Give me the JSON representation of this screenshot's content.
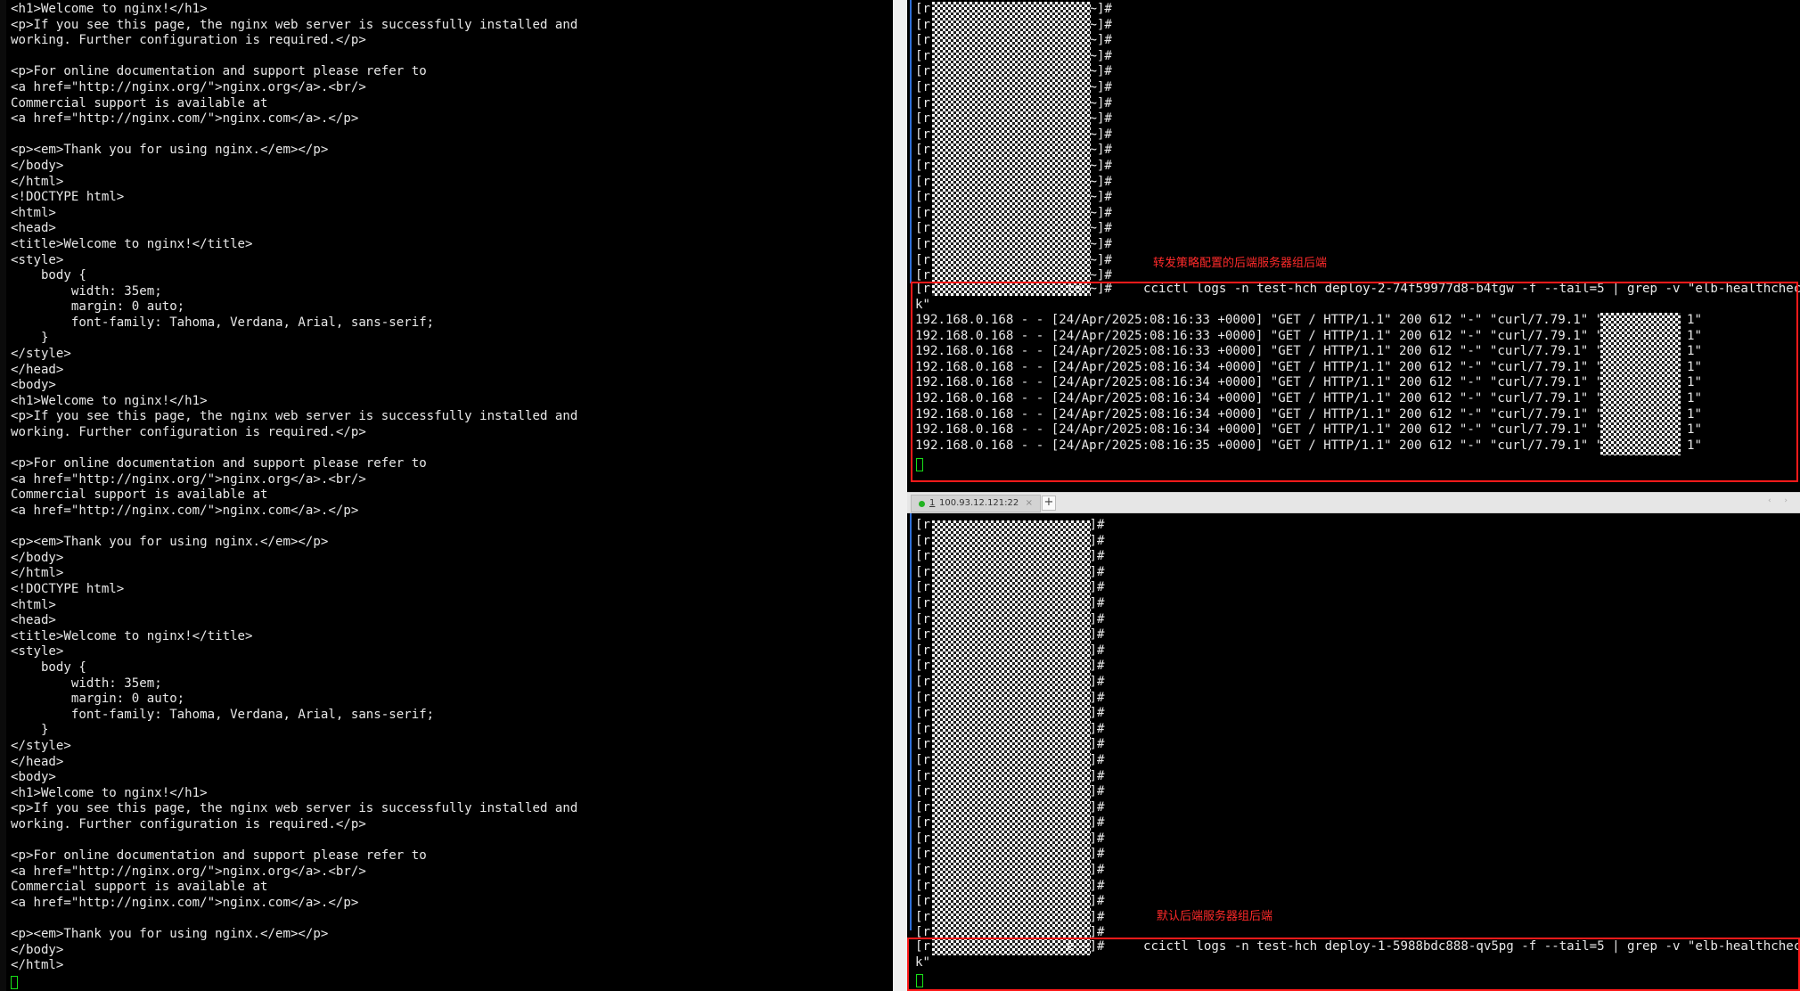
{
  "left_terminal": {
    "lines": [
      "<h1>Welcome to nginx!</h1>",
      "<p>If you see this page, the nginx web server is successfully installed and",
      "working. Further configuration is required.</p>",
      "",
      "<p>For online documentation and support please refer to",
      "<a href=\"http://nginx.org/\">nginx.org</a>.<br/>",
      "Commercial support is available at",
      "<a href=\"http://nginx.com/\">nginx.com</a>.</p>",
      "",
      "<p><em>Thank you for using nginx.</em></p>",
      "</body>",
      "</html>",
      "<!DOCTYPE html>",
      "<html>",
      "<head>",
      "<title>Welcome to nginx!</title>",
      "<style>",
      "    body {",
      "        width: 35em;",
      "        margin: 0 auto;",
      "        font-family: Tahoma, Verdana, Arial, sans-serif;",
      "    }",
      "</style>",
      "</head>",
      "<body>",
      "<h1>Welcome to nginx!</h1>",
      "<p>If you see this page, the nginx web server is successfully installed and",
      "working. Further configuration is required.</p>",
      "",
      "<p>For online documentation and support please refer to",
      "<a href=\"http://nginx.org/\">nginx.org</a>.<br/>",
      "Commercial support is available at",
      "<a href=\"http://nginx.com/\">nginx.com</a>.</p>",
      "",
      "<p><em>Thank you for using nginx.</em></p>",
      "</body>",
      "</html>",
      "<!DOCTYPE html>",
      "<html>",
      "<head>",
      "<title>Welcome to nginx!</title>",
      "<style>",
      "    body {",
      "        width: 35em;",
      "        margin: 0 auto;",
      "        font-family: Tahoma, Verdana, Arial, sans-serif;",
      "    }",
      "</style>",
      "</head>",
      "<body>",
      "<h1>Welcome to nginx!</h1>",
      "<p>If you see this page, the nginx web server is successfully installed and",
      "working. Further configuration is required.</p>",
      "",
      "<p>For online documentation and support please refer to",
      "<a href=\"http://nginx.org/\">nginx.org</a>.<br/>",
      "Commercial support is available at",
      "<a href=\"http://nginx.com/\">nginx.com</a>.</p>",
      "",
      "<p><em>Thank you for using nginx.</em></p>",
      "</body>",
      "</html>"
    ]
  },
  "top_terminal": {
    "prompt_prefix": "[r",
    "prompt_suffix": "te ~]#",
    "annotation": "转发策略配置的后端服务器组后端",
    "command": "ccictl logs -n test-hch deploy-2-74f59977d8-b4tgw -f --tail=5 | grep -v \"elb-healthchec",
    "command_wrap": "k\"",
    "log_lines": [
      {
        "text": "192.168.0.168 - - [24/Apr/2025:08:16:33 +0000] \"GET / HTTP/1.1\" 200 612 \"-\" \"curl/7.79.1\" \"10",
        "tail": "1\""
      },
      {
        "text": "192.168.0.168 - - [24/Apr/2025:08:16:33 +0000] \"GET / HTTP/1.1\" 200 612 \"-\" \"curl/7.79.1\" \"10",
        "tail": "1\""
      },
      {
        "text": "192.168.0.168 - - [24/Apr/2025:08:16:33 +0000] \"GET / HTTP/1.1\" 200 612 \"-\" \"curl/7.79.1\" \"10",
        "tail": "1\""
      },
      {
        "text": "192.168.0.168 - - [24/Apr/2025:08:16:34 +0000] \"GET / HTTP/1.1\" 200 612 \"-\" \"curl/7.79.1\" \"10",
        "tail": "1\""
      },
      {
        "text": "192.168.0.168 - - [24/Apr/2025:08:16:34 +0000] \"GET / HTTP/1.1\" 200 612 \"-\" \"curl/7.79.1\" \"10",
        "tail": "1\""
      },
      {
        "text": "192.168.0.168 - - [24/Apr/2025:08:16:34 +0000] \"GET / HTTP/1.1\" 200 612 \"-\" \"curl/7.79.1\" \"10",
        "tail": "1\""
      },
      {
        "text": "192.168.0.168 - - [24/Apr/2025:08:16:34 +0000] \"GET / HTTP/1.1\" 200 612 \"-\" \"curl/7.79.1\" \"10",
        "tail": "1\""
      },
      {
        "text": "192.168.0.168 - - [24/Apr/2025:08:16:34 +0000] \"GET / HTTP/1.1\" 200 612 \"-\" \"curl/7.79.1\" \"10",
        "tail": "1\""
      },
      {
        "text": "192.168.0.168 - - [24/Apr/2025:08:16:35 +0000] \"GET / HTTP/1.1\" 200 612 \"-\" \"curl/7.79.1\" \"10",
        "tail": "1\""
      }
    ]
  },
  "tab_bar": {
    "tab_number": "1",
    "tab_label": "100.93.12.121:22",
    "close_glyph": "×",
    "add_glyph": "+",
    "nav_glyphs": "‹ ›",
    "status_color": "#22b322"
  },
  "bottom_terminal": {
    "prompt_prefix": "[r",
    "prompt_suffix": "e ~]#",
    "annotation": "默认后端服务器组后端",
    "command": "ccictl logs -n test-hch deploy-1-5988bdc888-qv5pg -f --tail=5 | grep -v \"elb-healthchec",
    "command_wrap": "k\""
  },
  "colors": {
    "annotation_red": "#ff2a2a",
    "box_red": "#ff1a1a",
    "cursor_green": "#18e018",
    "terminal_text": "#e8e8e8"
  }
}
